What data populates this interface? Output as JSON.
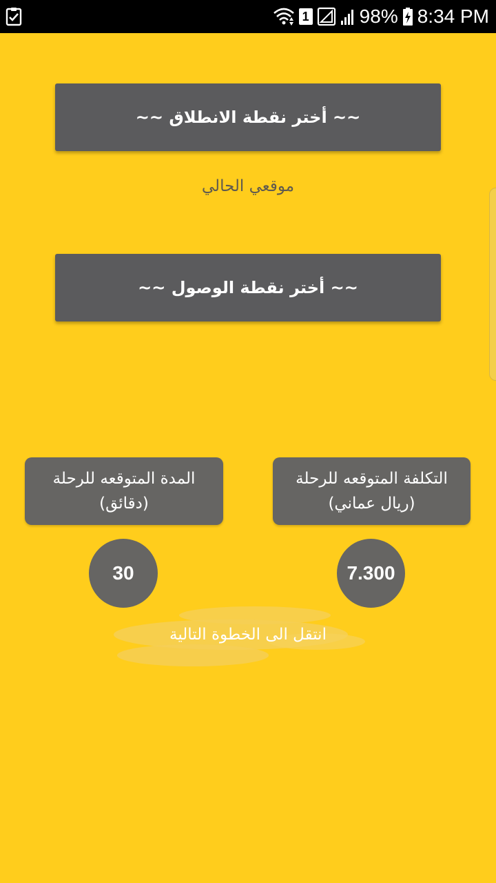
{
  "status_bar": {
    "battery": "98%",
    "time": "8:34 PM",
    "sim_badge": "1",
    "icons": [
      "checklist-icon",
      "wifi-icon",
      "sim-icon",
      "signal-icon",
      "battery-charging-icon"
    ]
  },
  "trip": {
    "start_button": "~~ أختر نقطة الانطلاق ~~",
    "current_location": "موقعي الحالي",
    "destination_button": "~~ أختر نقطة الوصول ~~"
  },
  "duration": {
    "label_line1": "المدة المتوقعه للرحلة",
    "label_line2": "(دقائق)",
    "value": "30"
  },
  "cost": {
    "label_line1": "التكلفة المتوقعه للرحلة",
    "label_line2": "(ريال عماني)",
    "value": "7.300"
  },
  "next_step": "انتقل الى الخطوة التالية",
  "colors": {
    "background": "#ffcd1c",
    "button": "#5b5b5d",
    "info_box": "#666563",
    "text_light": "#ffffff"
  }
}
